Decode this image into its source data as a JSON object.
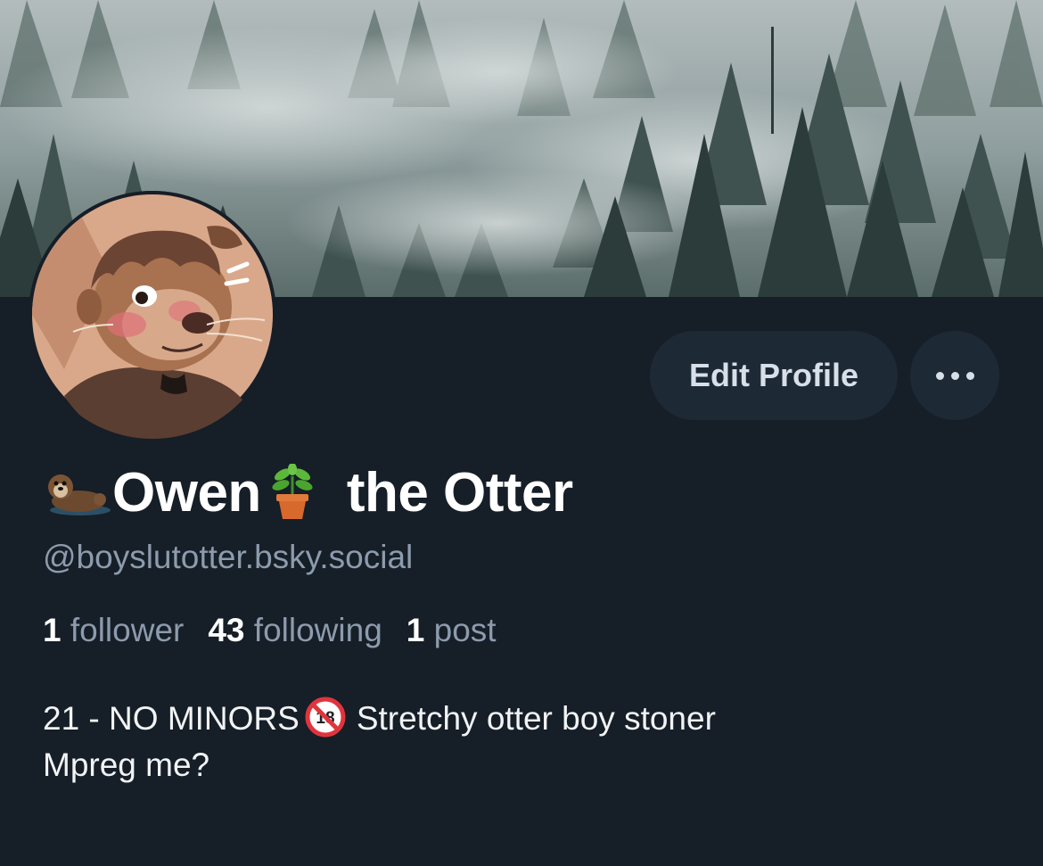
{
  "profile": {
    "display_name_part1": "Owen",
    "display_name_part2": "the Otter",
    "handle": "@boyslutotter.bsky.social",
    "stats": {
      "followers_count": "1",
      "followers_label": "follower",
      "following_count": "43",
      "following_label": "following",
      "posts_count": "1",
      "posts_label": "post"
    },
    "bio_line1_part1": "21 - NO MINORS",
    "bio_line1_part2": "Stretchy otter boy stoner",
    "bio_line2": "Mpreg me?"
  },
  "actions": {
    "edit_profile_label": "Edit Profile"
  },
  "icons": {
    "name_prefix": "otter-emoji",
    "name_middle": "potted-plant-emoji",
    "bio_badge": "no-one-under-eighteen-emoji",
    "more": "ellipsis-icon"
  },
  "colors": {
    "background": "#161e27",
    "button_bg": "#1e2936",
    "muted_text": "#8c9bad",
    "primary_text": "#ffffff"
  }
}
